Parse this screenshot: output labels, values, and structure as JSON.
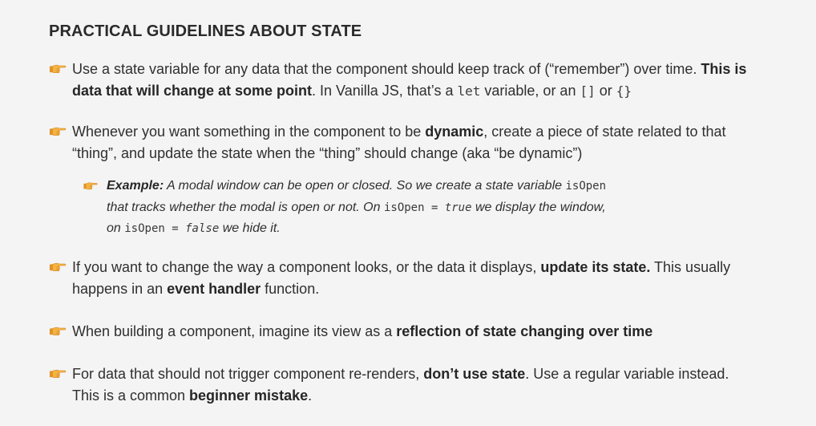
{
  "title": "PRACTICAL GUIDELINES ABOUT STATE",
  "colors": {
    "background": "#f4f4f4",
    "bullet_hand": "#f2a93b",
    "text": "#2f2f2f"
  },
  "bullet_icon": "pointing-hand-icon",
  "b1": {
    "t1": "Use a state variable for any data that the component should keep track of (“remember”) over time. ",
    "bold": "This is data that will change at some point",
    "t2": ". In Vanilla JS, that’s a ",
    "code1": "let",
    "t3": " variable, or an ",
    "code2": "[]",
    "t4": " or ",
    "code3": "{}"
  },
  "b2": {
    "t1": "Whenever you want something in the component to be ",
    "bold": "dynamic",
    "t2": ", create a piece of state related to that “thing”, and update the state when the “thing” should change (aka “be dynamic”)"
  },
  "example": {
    "label": "Example:",
    "t1": " A modal window can be open or closed. So we create a state variable ",
    "code1": "isOpen",
    "t2": " that tracks whether the modal is open or not. On ",
    "code2": "isOpen = ",
    "kw_true": "true",
    "t3": " we display the window, on ",
    "code3": "isOpen = ",
    "kw_false": "false",
    "t4": " we hide it."
  },
  "b3": {
    "t1": "If you want to change the way a component looks, or the data it displays, ",
    "bold1": "update its state.",
    "t2": " This usually happens in an ",
    "bold2": "event handler",
    "t3": " function."
  },
  "b4": {
    "t1": "When building a component, imagine its view as a ",
    "bold": "reflection of state changing over time"
  },
  "b5": {
    "t1": "For data that should not trigger component re-renders, ",
    "bold1": "don’t use state",
    "t2": ". Use a regular variable instead. This is a common ",
    "bold2": "beginner mistake",
    "t3": "."
  }
}
